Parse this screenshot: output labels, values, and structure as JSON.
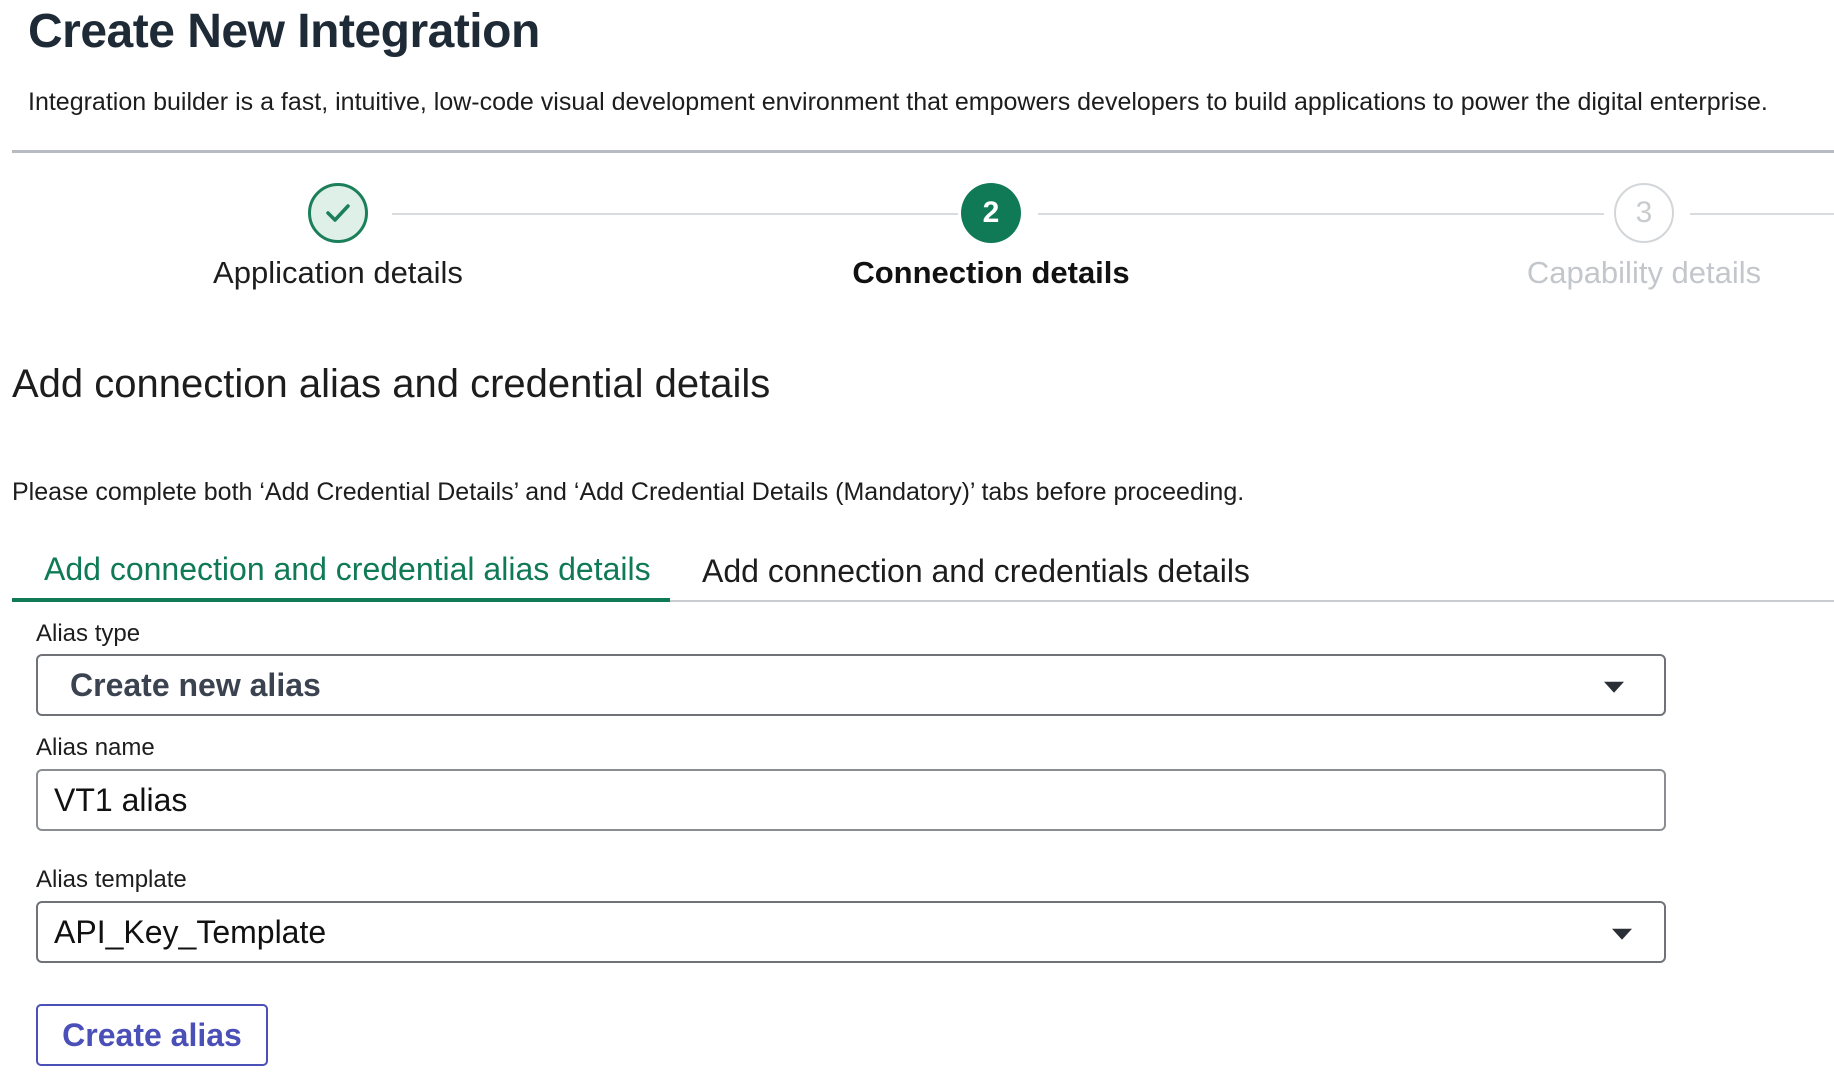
{
  "header": {
    "title": "Create New Integration",
    "description": "Integration builder is a fast, intuitive, low-code visual development environment that empowers developers to build applications to power the digital enterprise."
  },
  "stepper": {
    "steps": [
      {
        "number": "1",
        "label": "Application details",
        "state": "completed"
      },
      {
        "number": "2",
        "label": "Connection details",
        "state": "active"
      },
      {
        "number": "3",
        "label": "Capability details",
        "state": "pending"
      }
    ]
  },
  "section": {
    "title": "Add connection alias and credential details",
    "notice": "Please complete both ‘Add Credential Details’ and ‘Add Credential Details (Mandatory)’ tabs before proceeding."
  },
  "tabs": [
    {
      "label": "Add connection and credential alias details",
      "active": true
    },
    {
      "label": "Add connection and credentials details",
      "active": false
    }
  ],
  "form": {
    "alias_type": {
      "label": "Alias type",
      "value": "Create new alias"
    },
    "alias_name": {
      "label": "Alias name",
      "value": "VT1 alias"
    },
    "alias_template": {
      "label": "Alias template",
      "value": "API_Key_Template"
    },
    "create_button": "Create alias"
  },
  "colors": {
    "accent_green": "#0f7a55",
    "button_indigo": "#4b4fb8",
    "pending_gray": "#c3c7cb"
  },
  "icons": {
    "completed_step": "checkmark-icon",
    "select_caret": "caret-down-icon"
  }
}
